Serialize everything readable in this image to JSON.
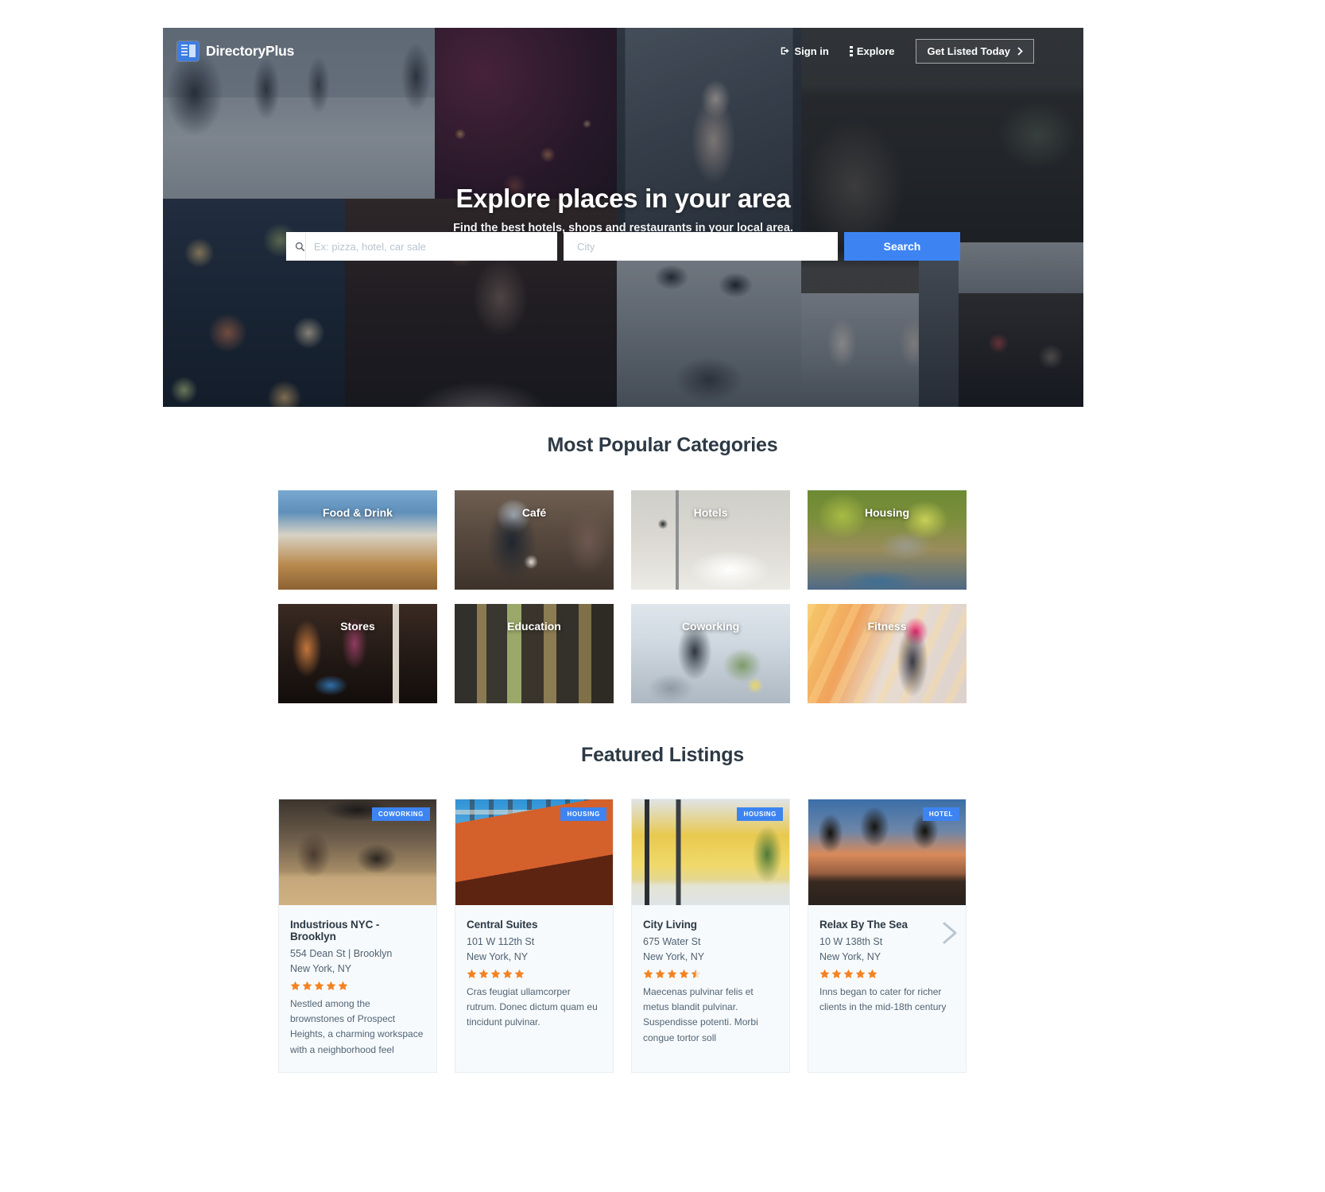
{
  "brand": {
    "name": "DirectoryPlus",
    "logo_icon": "directory-logo-icon",
    "accent": "#3d84f2"
  },
  "nav": {
    "sign_in": "Sign in",
    "sign_in_icon": "sign-in-icon",
    "explore": "Explore",
    "explore_icon": "dots-menu-icon",
    "cta": "Get Listed Today",
    "cta_icon": "chevron-right-icon"
  },
  "hero": {
    "title": "Explore places in your area",
    "subtitle": "Find the best hotels, shops and restaurants in your local area."
  },
  "search": {
    "query_placeholder": "Ex: pizza, hotel, car sale",
    "query_value": "",
    "city_placeholder": "City",
    "city_value": "",
    "search_label": "Search",
    "search_icon": "search-icon"
  },
  "categories_section": {
    "title": "Most Popular Categories",
    "items": [
      {
        "label": "Food & Drink",
        "image": "burger-and-fries-plate"
      },
      {
        "label": "Café",
        "image": "two-people-holding-coffee-cups"
      },
      {
        "label": "Hotels",
        "image": "white-hotel-bed-with-lamp"
      },
      {
        "label": "Housing",
        "image": "stone-cottage-with-garden"
      },
      {
        "label": "Stores",
        "image": "shop-front-with-open-sign"
      },
      {
        "label": "Education",
        "image": "library-bookshelf-aisle"
      },
      {
        "label": "Coworking",
        "image": "open-plan-coworking-office"
      },
      {
        "label": "Fitness",
        "image": "woman-in-pink-sports-top"
      }
    ]
  },
  "featured_section": {
    "title": "Featured Listings",
    "next_icon": "chevron-right-icon",
    "listings": [
      {
        "badge": "COWORKING",
        "image": "modern-coworking-lounge-interior",
        "name": "Industrious NYC - Brooklyn",
        "address": "554 Dean St | Brooklyn",
        "city": "New York, NY",
        "rating": 5,
        "description": "Nestled among the brownstones of Prospect Heights, a charming workspace with a neighborhood feel"
      },
      {
        "badge": "HOUSING",
        "image": "orange-brick-apartment-building",
        "name": "Central Suites",
        "address": "101 W 112th St",
        "city": "New York, NY",
        "rating": 5,
        "description": "Cras feugiat ullamcorper rutrum. Donec dictum quam eu tincidunt pulvinar."
      },
      {
        "badge": "HOUSING",
        "image": "yellow-modern-house-with-staircase",
        "name": "City Living",
        "address": "675 Water St",
        "city": "New York, NY",
        "rating": 4.5,
        "description": "Maecenas pulvinar felis et metus blandit pulvinar. Suspendisse potenti. Morbi congue tortor soll"
      },
      {
        "badge": "HOTEL",
        "image": "beach-palms-and-umbrellas-at-sunset",
        "name": "Relax By The Sea",
        "address": "10 W 138th St",
        "city": "New York, NY",
        "rating": 5,
        "description": "Inns began to cater for richer clients in the mid-18th century"
      }
    ]
  },
  "colors": {
    "star": "#f58220",
    "text_dark": "#2d3a45",
    "text_muted": "#516475"
  }
}
